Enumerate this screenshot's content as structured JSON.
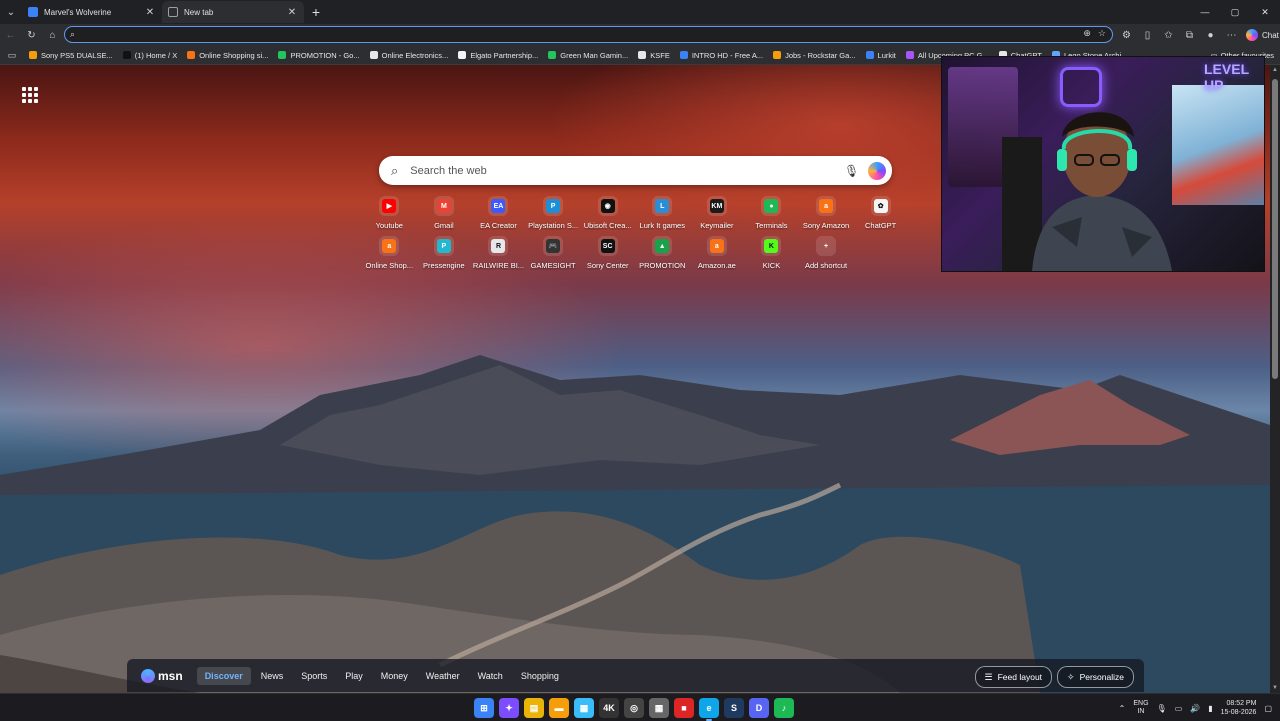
{
  "tabs": [
    {
      "title": "Marvel's Wolverine",
      "favicon_color": "#3b82f6",
      "active": false
    },
    {
      "title": "New tab",
      "favicon_color": "#9aa0a6",
      "active": true
    }
  ],
  "new_tab_symbol": "+",
  "window": {
    "minimize": "—",
    "maximize": "▢",
    "close": "✕"
  },
  "address_bar": {
    "value": "",
    "placeholder": ""
  },
  "toolbar_right": {
    "chat_label": "Chat"
  },
  "bookmarks": [
    {
      "label": "Sony PS5 DUALSE...",
      "color": "#f59e0b"
    },
    {
      "label": "(1) Home / X",
      "color": "#111111"
    },
    {
      "label": "Online Shopping si...",
      "color": "#f97316"
    },
    {
      "label": "PROMOTION - Go...",
      "color": "#22c55e"
    },
    {
      "label": "Online Electronics...",
      "color": "#e5e7eb"
    },
    {
      "label": "Elgato Partnership...",
      "color": "#f3f4f6"
    },
    {
      "label": "Green Man Gamin...",
      "color": "#22c55e"
    },
    {
      "label": "KSFE",
      "color": "#e5e7eb"
    },
    {
      "label": "INTRO HD - Free A...",
      "color": "#3b82f6"
    },
    {
      "label": "Jobs - Rockstar Ga...",
      "color": "#f59e0b"
    },
    {
      "label": "Lurkit",
      "color": "#3b82f6"
    },
    {
      "label": "All Upcoming PC G...",
      "color": "#a855f7"
    },
    {
      "label": "ChatGPT",
      "color": "#e5e7eb"
    },
    {
      "label": "Lego Stone Archi...",
      "color": "#60a5fa"
    }
  ],
  "bookmarks_other": "Other favourites",
  "search": {
    "placeholder": "Search the web"
  },
  "shortcuts": [
    {
      "label": "Youtube",
      "color": "#ff0000",
      "glyph": "▶"
    },
    {
      "label": "Gmail",
      "color": "#ea4335",
      "glyph": "M"
    },
    {
      "label": "EA Creator",
      "color": "#3b5bff",
      "glyph": "EA"
    },
    {
      "label": "Playstation S...",
      "color": "#1c8fd6",
      "glyph": "P"
    },
    {
      "label": "Ubisoft Crea...",
      "color": "#111111",
      "glyph": "◉"
    },
    {
      "label": "Lurk It games",
      "color": "#2a8ed6",
      "glyph": "L"
    },
    {
      "label": "Keymailer",
      "color": "#1b1b1b",
      "glyph": "KM"
    },
    {
      "label": "Terminals",
      "color": "#1db954",
      "glyph": "●"
    },
    {
      "label": "Sony Amazon",
      "color": "#f97316",
      "glyph": "a"
    },
    {
      "label": "ChatGPT",
      "color": "#f5f5f5",
      "glyph": "✿"
    },
    {
      "label": "Online Shop...",
      "color": "#f97316",
      "glyph": "a"
    },
    {
      "label": "Pressengine",
      "color": "#22b8cf",
      "glyph": "P"
    },
    {
      "label": "RAILWIRE BI...",
      "color": "#e5e7eb",
      "glyph": "R"
    },
    {
      "label": "GAMESIGHT",
      "color": "#333333",
      "glyph": "🎮"
    },
    {
      "label": "Sony Center",
      "color": "#111111",
      "glyph": "SC"
    },
    {
      "label": "PROMOTION",
      "color": "#16a34a",
      "glyph": "▲"
    },
    {
      "label": "Amazon.ae",
      "color": "#f97316",
      "glyph": "a"
    },
    {
      "label": "KICK",
      "color": "#53fc18",
      "glyph": "K"
    },
    {
      "label": "Add shortcut",
      "color": "transparent",
      "glyph": "+"
    }
  ],
  "msn": {
    "logo": "msn",
    "nav": [
      "Discover",
      "News",
      "Sports",
      "Play",
      "Money",
      "Weather",
      "Watch",
      "Shopping"
    ],
    "active_nav": "Discover",
    "feed_layout": "Feed layout",
    "personalize": "Personalize"
  },
  "webcam": {
    "overlay_text": "LEVEL UP"
  },
  "taskbar": {
    "apps": [
      {
        "name": "start",
        "color": "#3b82f6",
        "glyph": "⊞"
      },
      {
        "name": "copilot",
        "color": "#7c4dff",
        "glyph": "✦"
      },
      {
        "name": "notes",
        "color": "#eab308",
        "glyph": "▤"
      },
      {
        "name": "file-explorer",
        "color": "#f59e0b",
        "glyph": "▬"
      },
      {
        "name": "photos",
        "color": "#38bdf8",
        "glyph": "▦"
      },
      {
        "name": "4k",
        "color": "#333333",
        "glyph": "4K"
      },
      {
        "name": "obs",
        "color": "#444444",
        "glyph": "◎"
      },
      {
        "name": "calculator",
        "color": "#666666",
        "glyph": "▦"
      },
      {
        "name": "red-app",
        "color": "#dc2626",
        "glyph": "■"
      },
      {
        "name": "edge",
        "color": "#0ea5e9",
        "glyph": "e"
      },
      {
        "name": "steam",
        "color": "#1e3a5f",
        "glyph": "S"
      },
      {
        "name": "discord",
        "color": "#5865f2",
        "glyph": "D"
      },
      {
        "name": "spotify",
        "color": "#1db954",
        "glyph": "♪"
      }
    ],
    "lang_top": "ENG",
    "lang_bottom": "IN",
    "time": "08:52 PM",
    "date": "15-08-2026"
  }
}
